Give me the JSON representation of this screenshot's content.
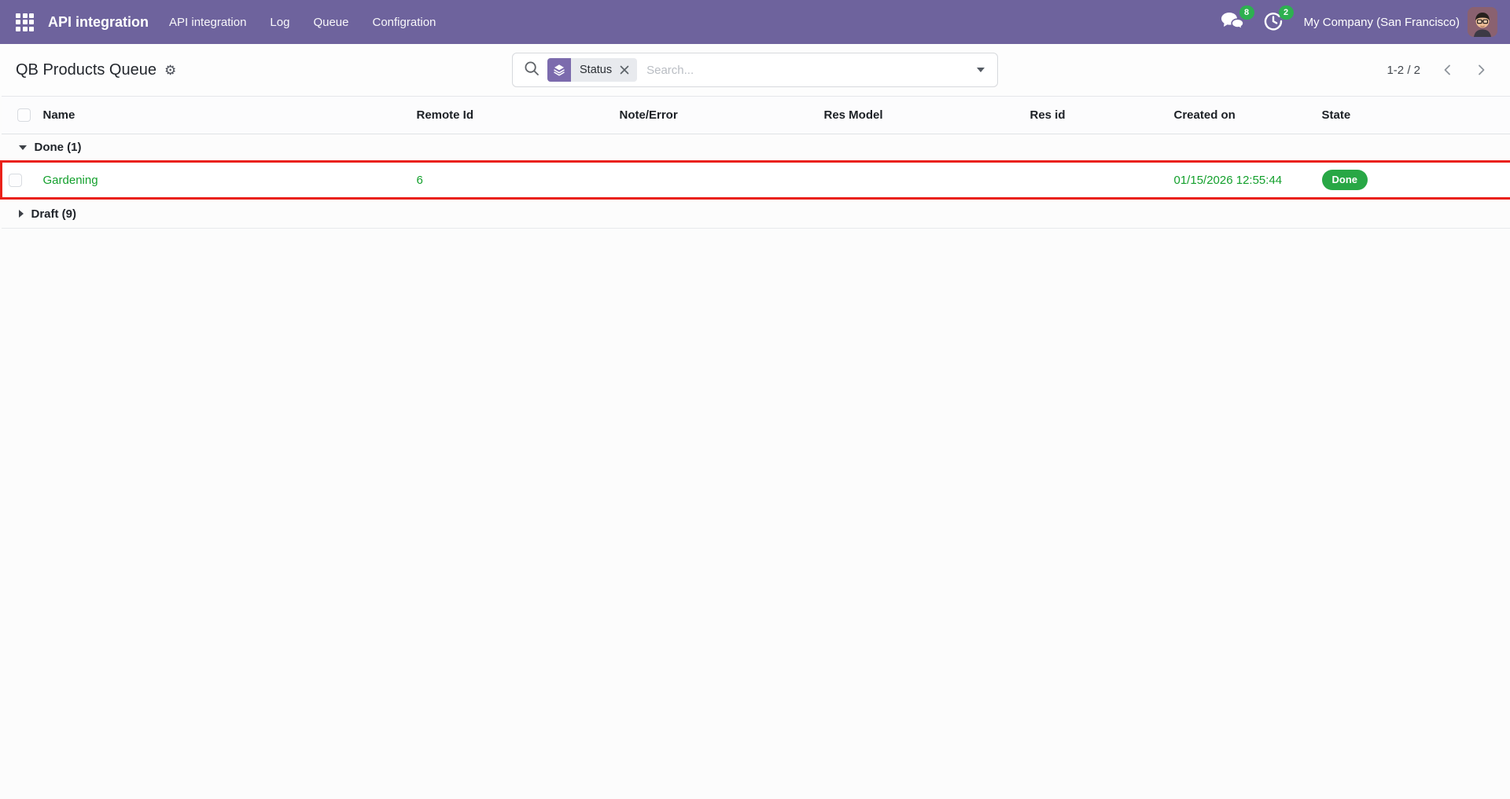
{
  "colors": {
    "navbar_bg": "#6e639d",
    "facet_purple": "#7c6bad",
    "notification_green": "#2db050",
    "success_badge_green": "#28a745",
    "success_text_green": "#14a02d",
    "highlight_red": "#ea2119"
  },
  "icons": {
    "gear": "⚙"
  },
  "navbar": {
    "app_name": "API integration",
    "menu_items": [
      "API integration",
      "Log",
      "Queue",
      "Configration"
    ],
    "messages_badge": "8",
    "activities_badge": "2",
    "company_name": "My Company (San Francisco)"
  },
  "control_panel": {
    "title": "QB Products Queue",
    "search": {
      "facet_label": "Status",
      "placeholder": "Search..."
    },
    "pager": {
      "text": "1-2 / 2"
    }
  },
  "list": {
    "columns": [
      "Name",
      "Remote Id",
      "Note/Error",
      "Res Model",
      "Res id",
      "Created on",
      "State"
    ],
    "groups": [
      {
        "label": "Done (1)",
        "expanded": true
      },
      {
        "label": "Draft (9)",
        "expanded": false
      }
    ],
    "row": {
      "name": "Gardening",
      "remote_id": "6",
      "created_on": "01/15/2026 12:55:44",
      "state": "Done"
    }
  }
}
